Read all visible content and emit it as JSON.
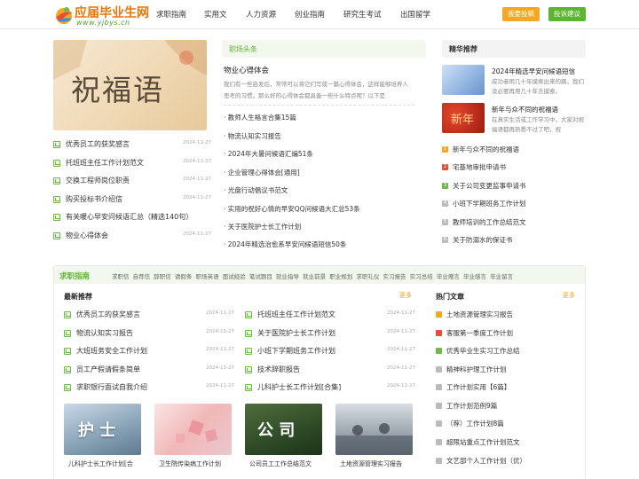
{
  "header": {
    "logo_brand": "应届毕业生网",
    "logo_url": "www.yjbys.cn",
    "nav": [
      "求职指南",
      "实用文",
      "人力资源",
      "创业指南",
      "研究生考试",
      "出国留学"
    ],
    "btn_submit": "我要投稿",
    "btn_suggest": "投诉建议",
    "colors": {
      "orange": "#f5a623",
      "green": "#5cb531"
    }
  },
  "banner": {
    "text": "祝福语"
  },
  "left_list": [
    {
      "title": "优秀员工的获奖感言",
      "date": "2024-11-27"
    },
    {
      "title": "托班班主任工作计划范文",
      "date": "2024-11-27"
    },
    {
      "title": "交换工程师岗位职责",
      "date": "2024-11-27"
    },
    {
      "title": "购买投标书介绍信",
      "date": "2024-11-27"
    },
    {
      "title": "有关暖心早安问候语汇总（精选140句）",
      "date": "2024-11-27"
    },
    {
      "title": "物业心得体会",
      "date": "2024-11-27"
    }
  ],
  "middle": {
    "head": "职场头条",
    "feature_title": "物业心得体会",
    "feature_desc": "我们有一些启发后，常常可以将它们写成一篇心得体会，这样能够培养人思考的习惯。那么好的心得体会都具备一些什么特点呢？以下是",
    "items": [
      "教师人生格言合集15篇",
      "物流认知实习报告",
      "2024年大暑问候语汇编51条",
      "企业管理心得体会[通用]",
      "光盘行动倡议书范文",
      "实用的祝好心情的早安QQ问候语大汇总53条",
      "关于医院护士长工作计划",
      "2024年精选治愈系早安问候语短信50条"
    ]
  },
  "right": {
    "head": "精华推荐",
    "card1_title": "2024年精选早安问候语短信",
    "card1_desc": "成功者用几十年摸索出来的路，我们没必要再用几十年去摸索。",
    "card2_img": "新年",
    "card2_title": "新年与众不同的祝福语",
    "card2_desc": "在真实生活或工作学习中，大家对祝福语都再熟悉不过了吧，祝",
    "items": [
      {
        "n": "1",
        "title": "新年与众不同的祝福语",
        "color": "#f5a623"
      },
      {
        "n": "2",
        "title": "宅基地审批申请书",
        "color": "#e84c3d"
      },
      {
        "n": "3",
        "title": "关于公司变更监事申请书",
        "color": "#6fb94d"
      },
      {
        "n": "4",
        "title": "小班下学期班务工作计划",
        "color": "#bbbbbb"
      },
      {
        "n": "5",
        "title": "教师培训的工作总结范文",
        "color": "#bbbbbb"
      },
      {
        "n": "6",
        "title": "关于防溺水的保证书",
        "color": "#bbbbbb"
      }
    ]
  },
  "career": {
    "head": "求职指南",
    "tags": [
      "求职信",
      "自荐信",
      "辞职信",
      "请假条",
      "职场英语",
      "面试经验",
      "笔试题目",
      "就业指导",
      "就业前景",
      "职业规划",
      "求职礼仪",
      "实习报告",
      "实习总结",
      "毕业赠言",
      "毕业感言",
      "毕业留言"
    ],
    "latest_head": "最新推荐",
    "more": "更多",
    "latest_left": [
      {
        "title": "优秀员工的获奖感言",
        "date": "2024-11-27"
      },
      {
        "title": "物流认知实习报告",
        "date": "2024-11-27"
      },
      {
        "title": "大班班务安全工作计划",
        "date": "2024-11-27"
      },
      {
        "title": "员工产假请假条简单",
        "date": "2024-11-27"
      },
      {
        "title": "求职银行面试自我介绍",
        "date": "2024-11-27"
      }
    ],
    "latest_right": [
      {
        "title": "托班班主任工作计划范文",
        "date": "2024-11-27"
      },
      {
        "title": "关于医院护士长工作计划",
        "date": "2024-11-27"
      },
      {
        "title": "小班下学期班务工作计划",
        "date": "2024-11-27"
      },
      {
        "title": "技术辞职报告",
        "date": "2024-11-27"
      },
      {
        "title": "儿科护士长工作计划[合集]",
        "date": "2024-11-27"
      }
    ],
    "thumbs": [
      {
        "img": "护 士",
        "caption": "儿科护士长工作计划[合"
      },
      {
        "img": "",
        "caption": "卫生院传染病工作计划"
      },
      {
        "img": "公 司",
        "caption": "公司员工工作总结范文"
      },
      {
        "img": "",
        "caption": "土地资源管理实习报告"
      }
    ],
    "hot_head": "热门文章",
    "hot_more": "更多",
    "hot": [
      {
        "title": "土地资源管理实习报告",
        "color": "#f5a623"
      },
      {
        "title": "客服第一季度工作计划",
        "color": "#e84c3d"
      },
      {
        "title": "优秀毕业生实习工作总结",
        "color": "#6fb94d"
      },
      {
        "title": "精神科护理工作计划",
        "color": "#bbbbbb"
      },
      {
        "title": "工作计划实用【6篇】",
        "color": "#bbbbbb"
      },
      {
        "title": "工作计划范例9篇",
        "color": "#bbbbbb"
      },
      {
        "title": "（荐）工作计划8篇",
        "color": "#bbbbbb"
      },
      {
        "title": "超限站重点工作计划范文",
        "color": "#bbbbbb"
      },
      {
        "title": "文艺部个人工作计划（优）",
        "color": "#bbbbbb"
      }
    ]
  }
}
